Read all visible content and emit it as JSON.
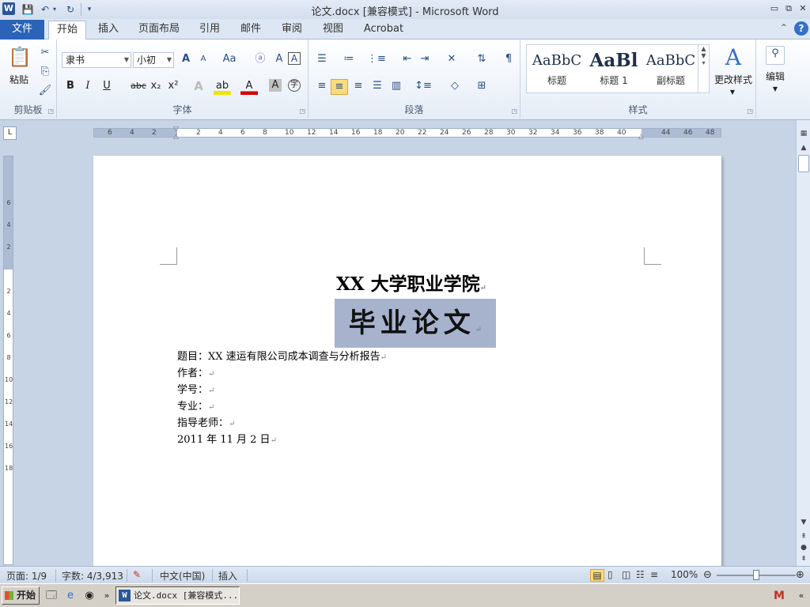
{
  "app": {
    "window_title": "论文.docx [兼容模式]  -  Microsoft Word",
    "icon_letter": "W",
    "brand_color": "#2b63b9"
  },
  "quick_access": {
    "save": "💾",
    "undo": "↶",
    "redo": "↻",
    "customize": "▾"
  },
  "window_controls": {
    "minimize": "▭",
    "restore": "⧉",
    "close": "✕"
  },
  "tabs": {
    "file": "文件",
    "items": [
      "开始",
      "插入",
      "页面布局",
      "引用",
      "邮件",
      "审阅",
      "视图",
      "Acrobat"
    ],
    "active": "开始",
    "help": "?"
  },
  "ribbon": {
    "clipboard": {
      "label": "剪贴板",
      "paste": "粘贴"
    },
    "font": {
      "label": "字体",
      "font_name": "隶书",
      "font_size": "小初",
      "grow": "A",
      "shrink": "A",
      "change_case": "Aa",
      "clear": "A",
      "bold": "B",
      "italic": "I",
      "underline": "U",
      "strike": "abc",
      "subscript": "x₂",
      "superscript": "x²",
      "text_effect": "A",
      "highlight": "ab",
      "font_color": "A",
      "char_shading": "A",
      "enclose": "字"
    },
    "paragraph": {
      "label": "段落"
    },
    "styles": {
      "label": "样式",
      "items": [
        {
          "preview": "AaBbC",
          "name": "标题"
        },
        {
          "preview": "AaBl",
          "name": "标题 1"
        },
        {
          "preview": "AaBbC",
          "name": "副标题"
        }
      ],
      "change_styles": "更改样式"
    },
    "editing": {
      "label": "编辑"
    }
  },
  "ruler": {
    "h_numbers": [
      "6",
      "4",
      "2",
      "2",
      "4",
      "6",
      "8",
      "10",
      "12",
      "14",
      "16",
      "18",
      "20",
      "22",
      "24",
      "26",
      "28",
      "30",
      "32",
      "34",
      "36",
      "38",
      "40",
      "44",
      "46",
      "48"
    ],
    "v_numbers": [
      "6",
      "4",
      "2",
      "2",
      "4",
      "6",
      "8",
      "10",
      "12",
      "14",
      "16",
      "18"
    ]
  },
  "document": {
    "title": "XX 大学职业学院",
    "subtitle": "毕业论文",
    "lines": [
      "题目：XX 速运有限公司成本调查与分析报告",
      "作者：",
      "学号：",
      "专业：",
      "指导老师：",
      "2011 年 11 月 2 日"
    ],
    "para_mark": "↵",
    "selection_color": "#a7b3cd"
  },
  "status": {
    "page": "页面: 1/9",
    "words": "字数: 4/3,913",
    "language": "中文(中国)",
    "mode": "插入",
    "zoom": "100%",
    "zoom_level": 1.0
  },
  "taskbar": {
    "start": "开始",
    "task": "论文.docx [兼容模式..."
  }
}
